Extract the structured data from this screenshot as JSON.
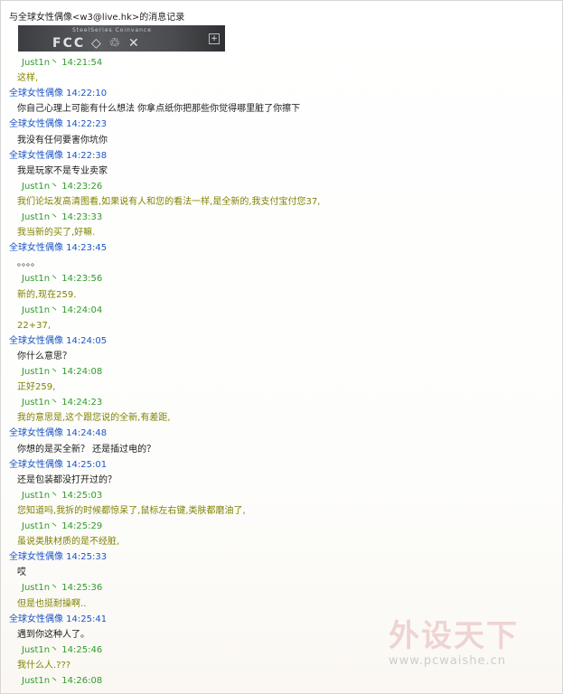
{
  "window_title": "与全球女性偶像<w3@live.hk>的消息记录",
  "photo": {
    "marks": "FCC ◇ ♲ ✕",
    "fine_text": "SteelSeries Coinvance"
  },
  "messages": [
    {
      "sender": "Just1n丶",
      "time": "14:21:54",
      "text": "这样,",
      "me": true
    },
    {
      "sender": "全球女性偶像",
      "time": "14:22:10",
      "text": "你自己心理上可能有什么想法 你拿点纸你把那些你觉得哪里脏了你擦下",
      "me": false
    },
    {
      "sender": "全球女性偶像",
      "time": "14:22:23",
      "text": "我没有任何要害你坑你",
      "me": false
    },
    {
      "sender": "全球女性偶像",
      "time": "14:22:38",
      "text": "我是玩家不是专业卖家",
      "me": false
    },
    {
      "sender": "Just1n丶",
      "time": "14:23:26",
      "text": "我们论坛发高清图看,如果说有人和您的看法一样,是全新的,我支付宝付您37,",
      "me": true
    },
    {
      "sender": "Just1n丶",
      "time": "14:23:33",
      "text": "我当新的买了,好嘛.",
      "me": true
    },
    {
      "sender": "全球女性偶像",
      "time": "14:23:45",
      "text": "。。。。",
      "me": false
    },
    {
      "sender": "Just1n丶",
      "time": "14:23:56",
      "text": "新的,现在259.",
      "me": true
    },
    {
      "sender": "Just1n丶",
      "time": "14:24:04",
      "text": "22+37,",
      "me": true
    },
    {
      "sender": "全球女性偶像",
      "time": "14:24:05",
      "text": "你什么意思？",
      "me": false
    },
    {
      "sender": "Just1n丶",
      "time": "14:24:08",
      "text": "正好259,",
      "me": true
    },
    {
      "sender": "Just1n丶",
      "time": "14:24:23",
      "text": "我的意思是,这个跟您说的全新,有差距,",
      "me": true
    },
    {
      "sender": "全球女性偶像",
      "time": "14:24:48",
      "text": "你想的是买全新？ 还是插过电的？",
      "me": false
    },
    {
      "sender": "全球女性偶像",
      "time": "14:25:01",
      "text": "还是包装都没打开过的？",
      "me": false
    },
    {
      "sender": "Just1n丶",
      "time": "14:25:03",
      "text": "您知道吗,我拆的时候都惊呆了,鼠标左右键,类肤都磨油了,",
      "me": true
    },
    {
      "sender": "Just1n丶",
      "time": "14:25:29",
      "text": "虽说类肤材质的是不经脏,",
      "me": true
    },
    {
      "sender": "全球女性偶像",
      "time": "14:25:33",
      "text": "哎",
      "me": false
    },
    {
      "sender": "Just1n丶",
      "time": "14:25:36",
      "text": "但是也挺耐操啊..",
      "me": true
    },
    {
      "sender": "全球女性偶像",
      "time": "14:25:41",
      "text": "遇到你这种人了。",
      "me": false
    },
    {
      "sender": "Just1n丶",
      "time": "14:25:46",
      "text": "我什么人.???",
      "me": true
    },
    {
      "sender": "Just1n丶",
      "time": "14:26:08",
      "text": "",
      "me": true
    }
  ],
  "watermark": {
    "logo": "外设天下",
    "url": "www.pcwaishe.cn"
  }
}
